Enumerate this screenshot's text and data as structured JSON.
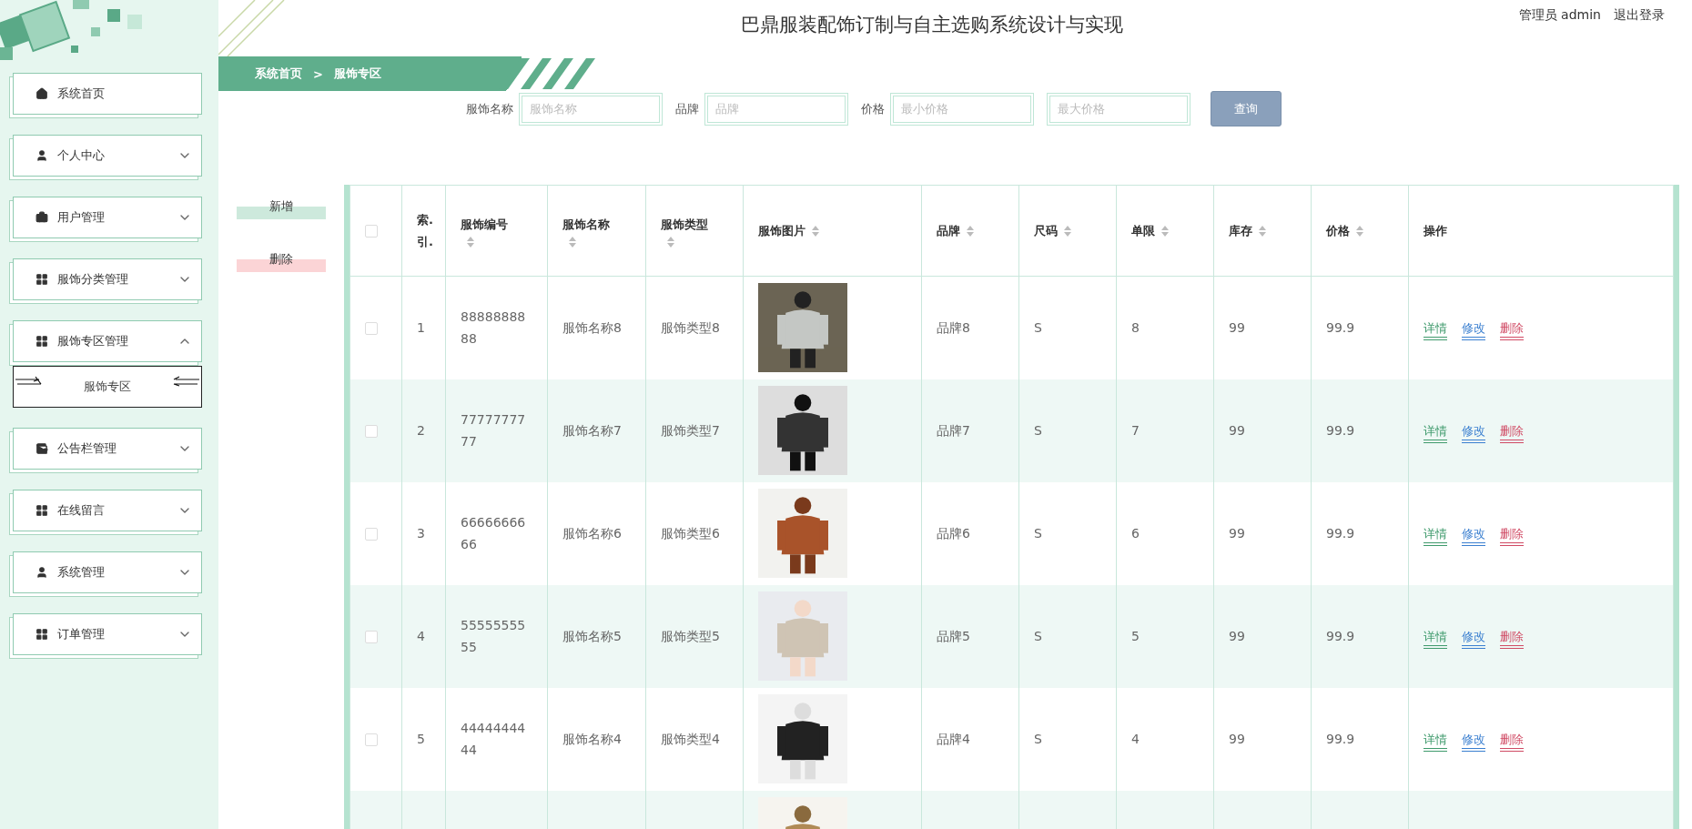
{
  "header": {
    "title": "巴鼎服装配饰订制与自主选购系统设计与实现",
    "user": "管理员 admin",
    "logout": "退出登录"
  },
  "breadcrumb": [
    "系统首页",
    ">",
    "服饰专区"
  ],
  "sidebar": {
    "items": [
      {
        "label": "系统首页"
      },
      {
        "label": "个人中心",
        "expanded": false
      },
      {
        "label": "用户管理",
        "expanded": false
      },
      {
        "label": "服饰分类管理",
        "expanded": false
      },
      {
        "label": "服饰专区管理",
        "expanded": true,
        "children": [
          {
            "label": "服饰专区",
            "selected": true
          }
        ]
      },
      {
        "label": "公告栏管理",
        "expanded": false
      },
      {
        "label": "在线留言",
        "expanded": false
      },
      {
        "label": "系统管理",
        "expanded": false
      },
      {
        "label": "订单管理",
        "expanded": false
      }
    ]
  },
  "search": {
    "fields": [
      {
        "label": "服饰名称",
        "placeholder": "服饰名称"
      },
      {
        "label": "品牌",
        "placeholder": "品牌"
      },
      {
        "label": "价格",
        "placeholder": "最小价格"
      },
      {
        "placeholder": "最大价格"
      }
    ],
    "button": "查询"
  },
  "actions": {
    "add": "新增",
    "delete": "删除"
  },
  "table": {
    "select_all": false,
    "columns": [
      {
        "label": "索.\n引."
      },
      {
        "label": "服饰编号",
        "sortable": true
      },
      {
        "label": "服饰名称",
        "sortable": true
      },
      {
        "label": "服饰类型",
        "sortable": true
      },
      {
        "label": "服饰图片",
        "sortable": true
      },
      {
        "label": "品牌",
        "sortable": true
      },
      {
        "label": "尺码",
        "sortable": true
      },
      {
        "label": "单限",
        "sortable": true
      },
      {
        "label": "库存",
        "sortable": true
      },
      {
        "label": "价格",
        "sortable": true
      },
      {
        "label": "操作"
      }
    ],
    "rows": [
      {
        "checked": false,
        "cells": [
          "1",
          "8888888888",
          "服饰名称8",
          "服饰类型8",
          null,
          "品牌8",
          "S",
          "8",
          "99",
          "99.9"
        ],
        "image": {
          "kind": "picture"
        },
        "ops": [
          "详情",
          "修改",
          "删除"
        ]
      },
      {
        "checked": false,
        "cells": [
          "2",
          "7777777777",
          "服饰名称7",
          "服饰类型7",
          null,
          "品牌7",
          "S",
          "7",
          "99",
          "99.9"
        ],
        "image": {
          "kind": "picture"
        },
        "ops": [
          "详情",
          "修改",
          "删除"
        ]
      },
      {
        "checked": false,
        "cells": [
          "3",
          "6666666666",
          "服饰名称6",
          "服饰类型6",
          null,
          "品牌6",
          "S",
          "6",
          "99",
          "99.9"
        ],
        "image": {
          "kind": "picture"
        },
        "ops": [
          "详情",
          "修改",
          "删除"
        ]
      },
      {
        "checked": false,
        "cells": [
          "4",
          "5555555555",
          "服饰名称5",
          "服饰类型5",
          null,
          "品牌5",
          "S",
          "5",
          "99",
          "99.9"
        ],
        "image": {
          "kind": "picture"
        },
        "ops": [
          "详情",
          "修改",
          "删除"
        ]
      },
      {
        "checked": false,
        "cells": [
          "5",
          "4444444444",
          "服饰名称4",
          "服饰类型4",
          null,
          "品牌4",
          "S",
          "4",
          "99",
          "99.9"
        ],
        "image": {
          "kind": "picture"
        },
        "ops": [
          "详情",
          "修改",
          "删除"
        ]
      },
      {
        "image": {
          "kind": "picture"
        }
      }
    ]
  }
}
